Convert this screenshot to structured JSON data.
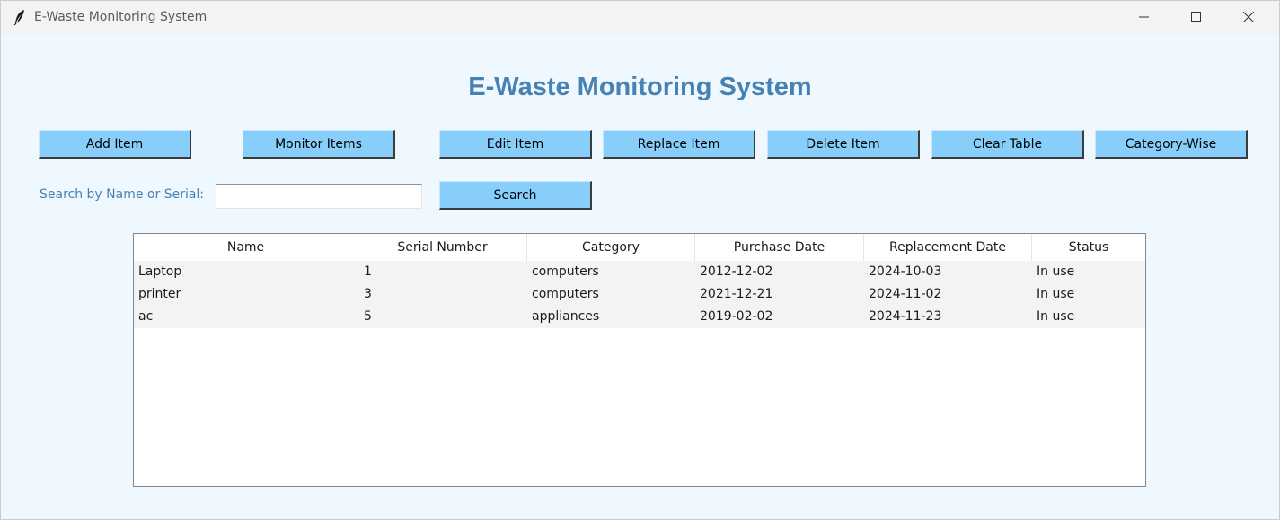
{
  "window": {
    "title": "E-Waste Monitoring System"
  },
  "app": {
    "heading": "E-Waste Monitoring System"
  },
  "toolbar": {
    "add_label": "Add Item",
    "monitor_label": "Monitor Items",
    "edit_label": "Edit Item",
    "replace_label": "Replace Item",
    "delete_label": "Delete Item",
    "clear_label": "Clear Table",
    "category_label": "Category-Wise"
  },
  "search": {
    "label": "Search by Name or Serial:",
    "value": "",
    "button_label": "Search"
  },
  "table": {
    "columns": [
      "Name",
      "Serial Number",
      "Category",
      "Purchase Date",
      "Replacement Date",
      "Status"
    ],
    "rows": [
      [
        "Laptop",
        "1",
        "computers",
        "2012-12-02",
        "2024-10-03",
        "In use"
      ],
      [
        "printer",
        "3",
        "computers",
        "2021-12-21",
        "2024-11-02",
        "In use"
      ],
      [
        "ac",
        "5",
        "appliances",
        "2019-02-02",
        "2024-11-23",
        "In use"
      ]
    ]
  },
  "colors": {
    "heading": "#4682b4",
    "button_bg": "#87cefa",
    "window_bg": "#f0f8ff",
    "row_bg": "#f3f3f3"
  },
  "icons": {
    "app": "feather-icon",
    "minimize": "minimize-icon",
    "maximize": "maximize-icon",
    "close": "close-icon"
  }
}
